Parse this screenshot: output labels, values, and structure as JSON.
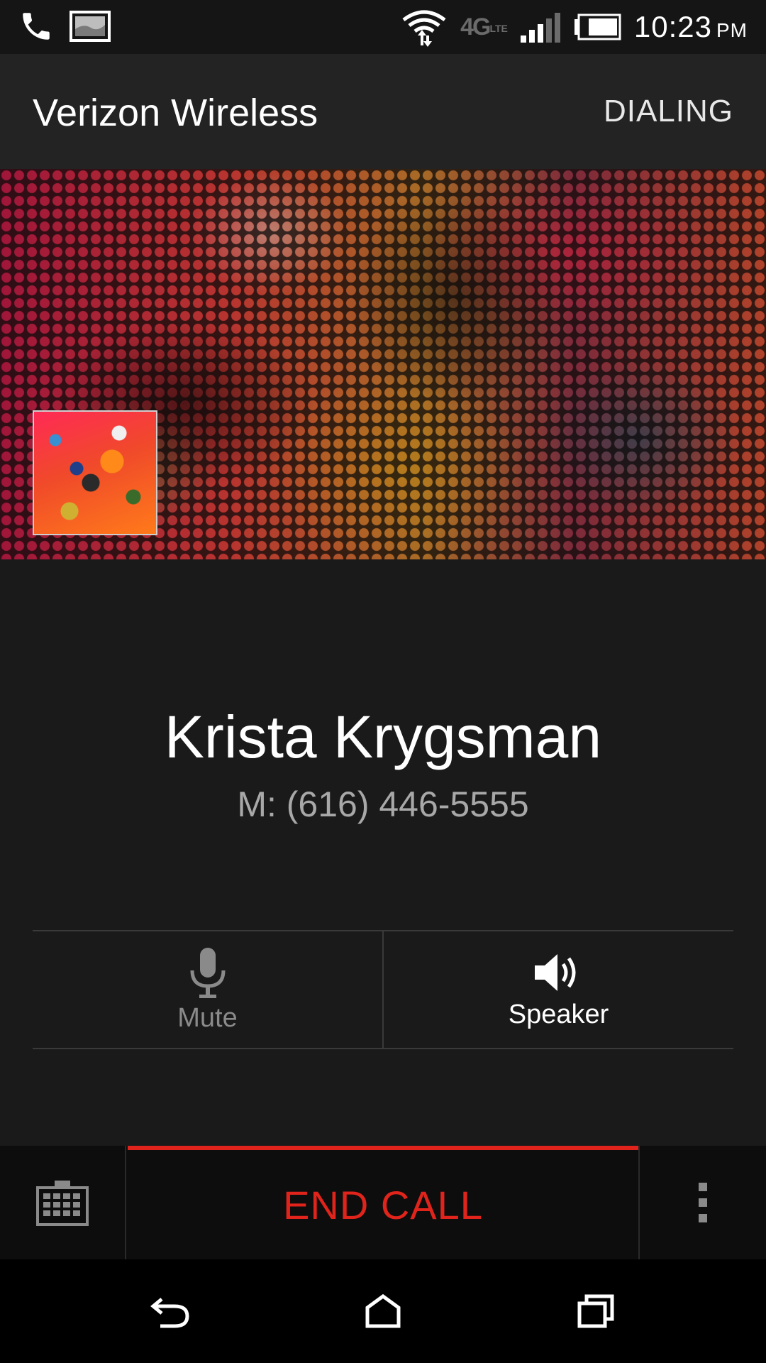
{
  "status_bar": {
    "icons": [
      "phone-call-icon",
      "picture-notification-icon",
      "wifi-data-icon",
      "4g-lte-icon",
      "signal-icon",
      "battery-icon"
    ],
    "network_label": "4G",
    "network_sub": "LTE",
    "time": "10:23",
    "meridiem": "PM"
  },
  "header": {
    "carrier": "Verizon Wireless",
    "state": "DIALING"
  },
  "caller": {
    "name": "Krista Krygsman",
    "number": "M: (616) 446-5555"
  },
  "controls": {
    "mute_label": "Mute",
    "mute_icon": "microphone-icon",
    "speaker_label": "Speaker",
    "speaker_icon": "speaker-icon"
  },
  "call_bar": {
    "dialpad_icon": "dialpad-icon",
    "end_call_label": "END CALL",
    "more_icon": "more-vert-icon",
    "end_call_color": "#e0241b"
  },
  "nav_bar": {
    "icons": [
      "back-icon",
      "home-icon",
      "recents-icon"
    ]
  }
}
